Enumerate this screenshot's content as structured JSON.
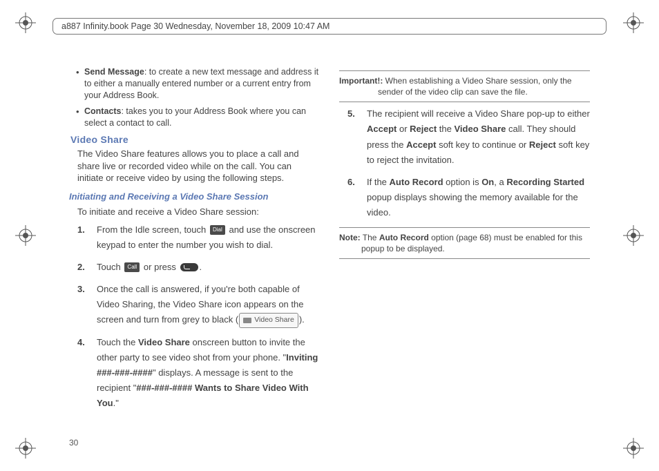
{
  "header": {
    "runner": "a887 Infinity.book  Page 30  Wednesday, November 18, 2009  10:47 AM"
  },
  "page_number": "30",
  "left": {
    "bullets": [
      {
        "term": "Send Message",
        "desc": ": to create a new text message and address it to either a manually entered number or a current entry from your Address Book."
      },
      {
        "term": "Contacts",
        "desc": ": takes you to your Address Book where you can select a contact to call."
      }
    ],
    "section_title": "Video Share",
    "section_body": "The Video Share features allows you to place a call and share live or recorded video while on the call. You can initiate or receive video by using the following steps.",
    "subsection_title": "Initiating and Receiving a Video Share Session",
    "intro": "To initiate and receive a Video Share session:",
    "step1a": "From the Idle screen, touch ",
    "step1b": " and use the onscreen keypad to enter the number you wish to dial.",
    "icon_dial": "Dial",
    "step2a": "Touch ",
    "icon_call": "Call",
    "step2b": " or press ",
    "step2c": ".",
    "step3": "Once the call is answered, if you're both capable of Video Sharing, the Video Share icon appears on the screen and turn from grey to black (",
    "vs_chip_label": "Video Share",
    "step3_end": ").",
    "step4a": "Touch the ",
    "step4b": "Video Share",
    "step4c": " onscreen button to invite the other party to see video shot from your phone. \"",
    "step4d": "Inviting ###-###-####",
    "step4e": "\" displays. A message is sent to the recipient \"",
    "step4f": "###-###-#### Wants to Share Video With You",
    "step4g": ".\""
  },
  "right": {
    "important_label": "Important!:",
    "important_text": " When establishing a Video Share session, only the sender of the video clip can save the file.",
    "step5a": "The recipient will receive a Video Share pop-up to either ",
    "step5b": "Accept",
    "step5c": " or ",
    "step5d": "Reject",
    "step5e": " the ",
    "step5f": "Video Share",
    "step5g": " call. They should press the ",
    "step5h": "Accept",
    "step5i": " soft key to continue or ",
    "step5j": "Reject",
    "step5k": " soft key to reject the invitation.",
    "step6a": "If the ",
    "step6b": "Auto Record",
    "step6c": " option is ",
    "step6d": "On",
    "step6e": ", a ",
    "step6f": "Recording Started",
    "step6g": " popup displays showing the memory available for the video.",
    "note_label": "Note:",
    "note_a": " The ",
    "note_b": "Auto Record",
    "note_c": " option (page 68) must be enabled for this popup to be displayed."
  }
}
